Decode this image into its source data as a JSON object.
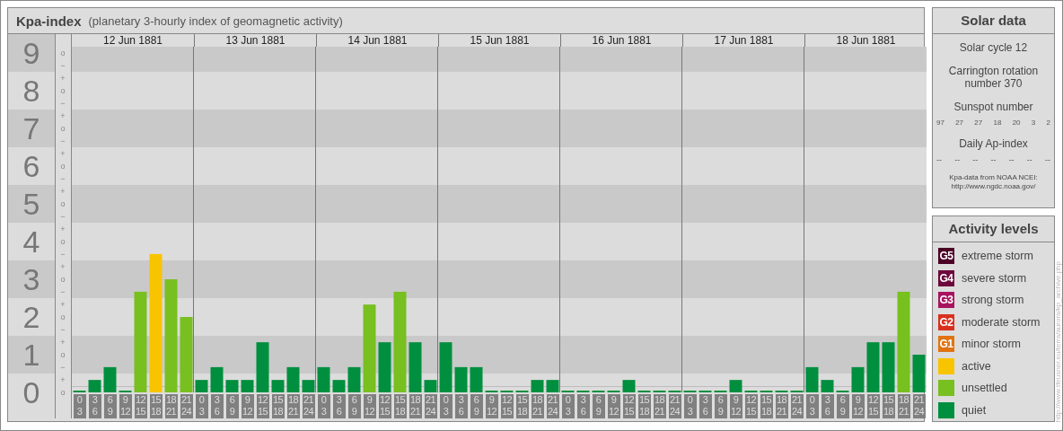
{
  "kpa_panel": {
    "title": "Kpa-index",
    "subtitle": "(planetary 3-hourly index of geomagnetic activity)",
    "levels": [
      {
        "marks": [
          "o",
          "−"
        ]
      },
      {
        "marks": [
          "+",
          "o",
          "−"
        ]
      },
      {
        "marks": [
          "+",
          "o",
          "−"
        ]
      },
      {
        "marks": [
          "+",
          "o",
          "−"
        ]
      },
      {
        "marks": [
          "+",
          "o",
          "−"
        ]
      },
      {
        "marks": [
          "+",
          "o",
          "−"
        ]
      },
      {
        "marks": [
          "+",
          "o",
          "−"
        ]
      },
      {
        "marks": [
          "+",
          "o",
          "−"
        ]
      },
      {
        "marks": [
          "+",
          "o",
          "−"
        ]
      },
      {
        "marks": [
          "+",
          "o"
        ]
      }
    ],
    "days": [
      "12 Jun 1881",
      "13 Jun 1881",
      "14 Jun 1881",
      "15 Jun 1881",
      "16 Jun 1881",
      "17 Jun 1881",
      "18 Jun 1881"
    ],
    "chart_data": {
      "type": "bar",
      "grid": true,
      "ylim": [
        0,
        9.17
      ],
      "yticks": [
        9,
        8,
        7,
        6,
        5,
        4,
        3,
        2,
        1,
        0
      ],
      "categories": [
        "0\n3",
        "3\n6",
        "6\n9",
        "9\n12",
        "12\n15",
        "15\n18",
        "18\n21",
        "21\n24",
        "0\n3",
        "3\n6",
        "6\n9",
        "9\n12",
        "12\n15",
        "15\n18",
        "18\n21",
        "21\n24",
        "0\n3",
        "3\n6",
        "6\n9",
        "9\n12",
        "12\n15",
        "15\n18",
        "18\n21",
        "21\n24",
        "0\n3",
        "3\n6",
        "6\n9",
        "9\n12",
        "12\n15",
        "15\n18",
        "18\n21",
        "21\n24",
        "0\n3",
        "3\n6",
        "6\n9",
        "9\n12",
        "12\n15",
        "15\n18",
        "18\n21",
        "21\n24",
        "0\n3",
        "3\n6",
        "6\n9",
        "9\n12",
        "12\n15",
        "15\n18",
        "18\n21",
        "21\n24",
        "0\n3",
        "3\n6",
        "6\n9",
        "9\n12",
        "12\n15",
        "15\n18",
        "18\n21",
        "21\n24"
      ],
      "series": [
        {
          "color": "#008f3e",
          "values": [
            0,
            0.33,
            0.67,
            0,
            null,
            null,
            null,
            null,
            0.33,
            0.67,
            0.33,
            0.33,
            1.33,
            0.33,
            0.67,
            0.33,
            0.67,
            0.33,
            0.67,
            null,
            1.33,
            null,
            1.33,
            0.33,
            1.33,
            0.67,
            0.67,
            0,
            0,
            0,
            0.33,
            0.33,
            0,
            0,
            0,
            0,
            0.33,
            0,
            0,
            0,
            0,
            0,
            0,
            0.33,
            0,
            0,
            0,
            0,
            0.67,
            0.33,
            0,
            0.67,
            1.33,
            1.33,
            null,
            1
          ]
        },
        {
          "color": "#78bf20",
          "values": [
            null,
            null,
            null,
            null,
            2.67,
            null,
            3,
            2,
            null,
            null,
            null,
            null,
            null,
            null,
            null,
            null,
            null,
            null,
            null,
            2.33,
            null,
            2.67,
            null,
            null,
            null,
            null,
            null,
            null,
            null,
            null,
            null,
            null,
            null,
            null,
            null,
            null,
            null,
            null,
            null,
            null,
            null,
            null,
            null,
            null,
            null,
            null,
            null,
            null,
            null,
            null,
            null,
            null,
            null,
            null,
            2.67,
            null
          ]
        },
        {
          "color": "#f8c400",
          "values": [
            null,
            null,
            null,
            null,
            null,
            3.67,
            null,
            null,
            null,
            null,
            null,
            null,
            null,
            null,
            null,
            null,
            null,
            null,
            null,
            null,
            null,
            null,
            null,
            null,
            null,
            null,
            null,
            null,
            null,
            null,
            null,
            null,
            null,
            null,
            null,
            null,
            null,
            null,
            null,
            null,
            null,
            null,
            null,
            null,
            null,
            null,
            null,
            null,
            null,
            null,
            null,
            null,
            null,
            null,
            null,
            null
          ]
        }
      ]
    }
  },
  "solar_data": {
    "title": "Solar data",
    "solar_cycle": "Solar cycle 12",
    "carrington": "Carrington rotation number 370",
    "sunspot_label": "Sunspot number",
    "sunspot_numbers": [
      "97",
      "27",
      "27",
      "18",
      "20",
      "3",
      "2"
    ],
    "ap_label": "Daily Ap-index",
    "ap_values": [
      "--",
      "--",
      "--",
      "--",
      "--",
      "--",
      "--"
    ],
    "source": "Kpa-data from NOAA NCEI:",
    "source_url": "http://www.ngdc.noaa.gov/"
  },
  "activity_levels": {
    "title": "Activity levels",
    "items": [
      {
        "badge": "G5",
        "label": "extreme storm",
        "color": "#4c0026"
      },
      {
        "badge": "G4",
        "label": "severe storm",
        "color": "#6e083c"
      },
      {
        "badge": "G3",
        "label": "strong storm",
        "color": "#a8135f"
      },
      {
        "badge": "G2",
        "label": "moderate storm",
        "color": "#d8301e"
      },
      {
        "badge": "G1",
        "label": "minor storm",
        "color": "#e07414"
      },
      {
        "label": "active",
        "color": "#f8c400"
      },
      {
        "label": "unsettled",
        "color": "#78bf20"
      },
      {
        "label": "quiet",
        "color": "#008f3e"
      }
    ]
  },
  "credit": "http://www.tfeusner.eu/terra/aurora/kp_archive.php"
}
